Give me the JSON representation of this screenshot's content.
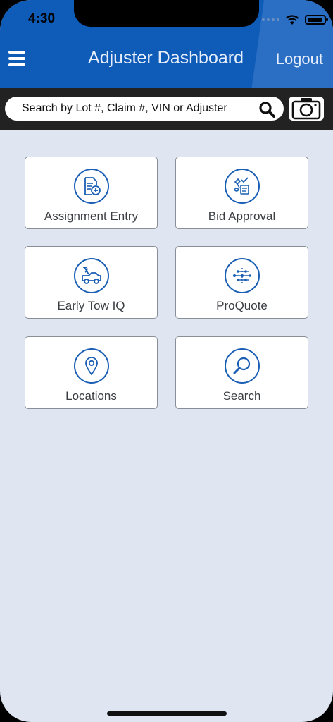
{
  "status_bar": {
    "time": "4:30"
  },
  "header": {
    "title": "Adjuster Dashboard",
    "logout_label": "Logout"
  },
  "search": {
    "placeholder": "Search by Lot #, Claim #, VIN or Adjuster"
  },
  "tiles": [
    {
      "label": "Assignment Entry",
      "icon": "assignment-entry-icon"
    },
    {
      "label": "Bid Approval",
      "icon": "bid-approval-icon"
    },
    {
      "label": "Early Tow IQ",
      "icon": "tow-truck-icon"
    },
    {
      "label": "ProQuote",
      "icon": "proquote-icon"
    },
    {
      "label": "Locations",
      "icon": "location-pin-icon"
    },
    {
      "label": "Search",
      "icon": "search-icon"
    }
  ],
  "colors": {
    "header": "#0f5bb8",
    "accent": "#1a5fb4",
    "background": "#dfe5f1",
    "search_strip": "#222222"
  }
}
